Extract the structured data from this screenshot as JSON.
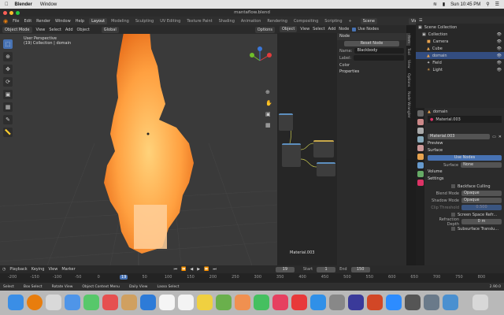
{
  "macos": {
    "app_name": "Blender",
    "menus": [
      "Window"
    ],
    "clock": "Sun 10:45 PM"
  },
  "window": {
    "title": "mantaflow.blend"
  },
  "menubar": {
    "menus": [
      "File",
      "Edit",
      "Render",
      "Window",
      "Help"
    ],
    "workspaces": [
      "Layout",
      "Modeling",
      "Sculpting",
      "UV Editing",
      "Texture Paint",
      "Shading",
      "Animation",
      "Rendering",
      "Compositing",
      "Scripting"
    ],
    "active_workspace": "Layout",
    "scene": "Scene",
    "view_layer": "View Layer"
  },
  "viewport": {
    "mode": "Object Mode",
    "menus": [
      "View",
      "Select",
      "Add",
      "Object"
    ],
    "orientation": "Global",
    "options": "Options",
    "info_line1": "User Perspective",
    "info_line2": "(19) Collection | domain"
  },
  "node_editor": {
    "editor_type": "Object",
    "menus": [
      "View",
      "Select",
      "Add",
      "Node"
    ],
    "use_nodes_label": "Use Nodes",
    "slot": "Slot 1",
    "material_label": "Material.003"
  },
  "node_panel": {
    "tabs": [
      "Item",
      "Tool",
      "View",
      "Options",
      "Node Wrangler"
    ],
    "section_node": "Node",
    "reset_node": "Reset Node",
    "name_label": "Name:",
    "name_value": "Blackbody",
    "label_label": "Label:",
    "color_label": "Color",
    "properties_label": "Properties"
  },
  "outliner": {
    "root": "Scene Collection",
    "items": [
      "Collection",
      "Camera",
      "Cube",
      "domain",
      "Field",
      "Light"
    ]
  },
  "properties": {
    "object": "domain",
    "material_slot": "Material.003",
    "material_name": "Material.003",
    "sections": [
      "Preview",
      "Surface",
      "Volume",
      "Settings"
    ],
    "use_nodes_button": "Use Nodes",
    "surface_label": "Surface",
    "surface_value": "None",
    "backface_culling": "Backface Culling",
    "blend_mode_label": "Blend Mode",
    "blend_mode_value": "Opaque",
    "shadow_mode_label": "Shadow Mode",
    "shadow_mode_value": "Opaque",
    "clip_threshold_label": "Clip Threshold",
    "clip_threshold_value": "0.500",
    "screen_space_refraction": "Screen Space Refr...",
    "refraction_depth_label": "Refraction Depth",
    "refraction_depth_value": "0 m",
    "subsurface_translucency": "Subsurface Translu..."
  },
  "timeline": {
    "menus": [
      "Playback",
      "Keying",
      "View",
      "Marker"
    ],
    "current_frame": "19",
    "start_label": "Start",
    "start_value": "1",
    "end_label": "End",
    "end_value": "150",
    "ruler": [
      "-200",
      "-150",
      "-100",
      "-50",
      "0",
      "19",
      "50",
      "100",
      "150",
      "200",
      "250",
      "300",
      "350",
      "400",
      "450",
      "500",
      "550",
      "600",
      "650",
      "700",
      "750",
      "800"
    ]
  },
  "status": {
    "items": [
      "Select",
      "Box Select",
      "Rotate View",
      "Object Context Menu",
      "Daily View",
      "Lasso Select"
    ],
    "version": "2.90.0"
  },
  "colors": {
    "accent": "#4772b3",
    "flame_core": "#ffb24a",
    "flame_edge": "#e0701c"
  }
}
